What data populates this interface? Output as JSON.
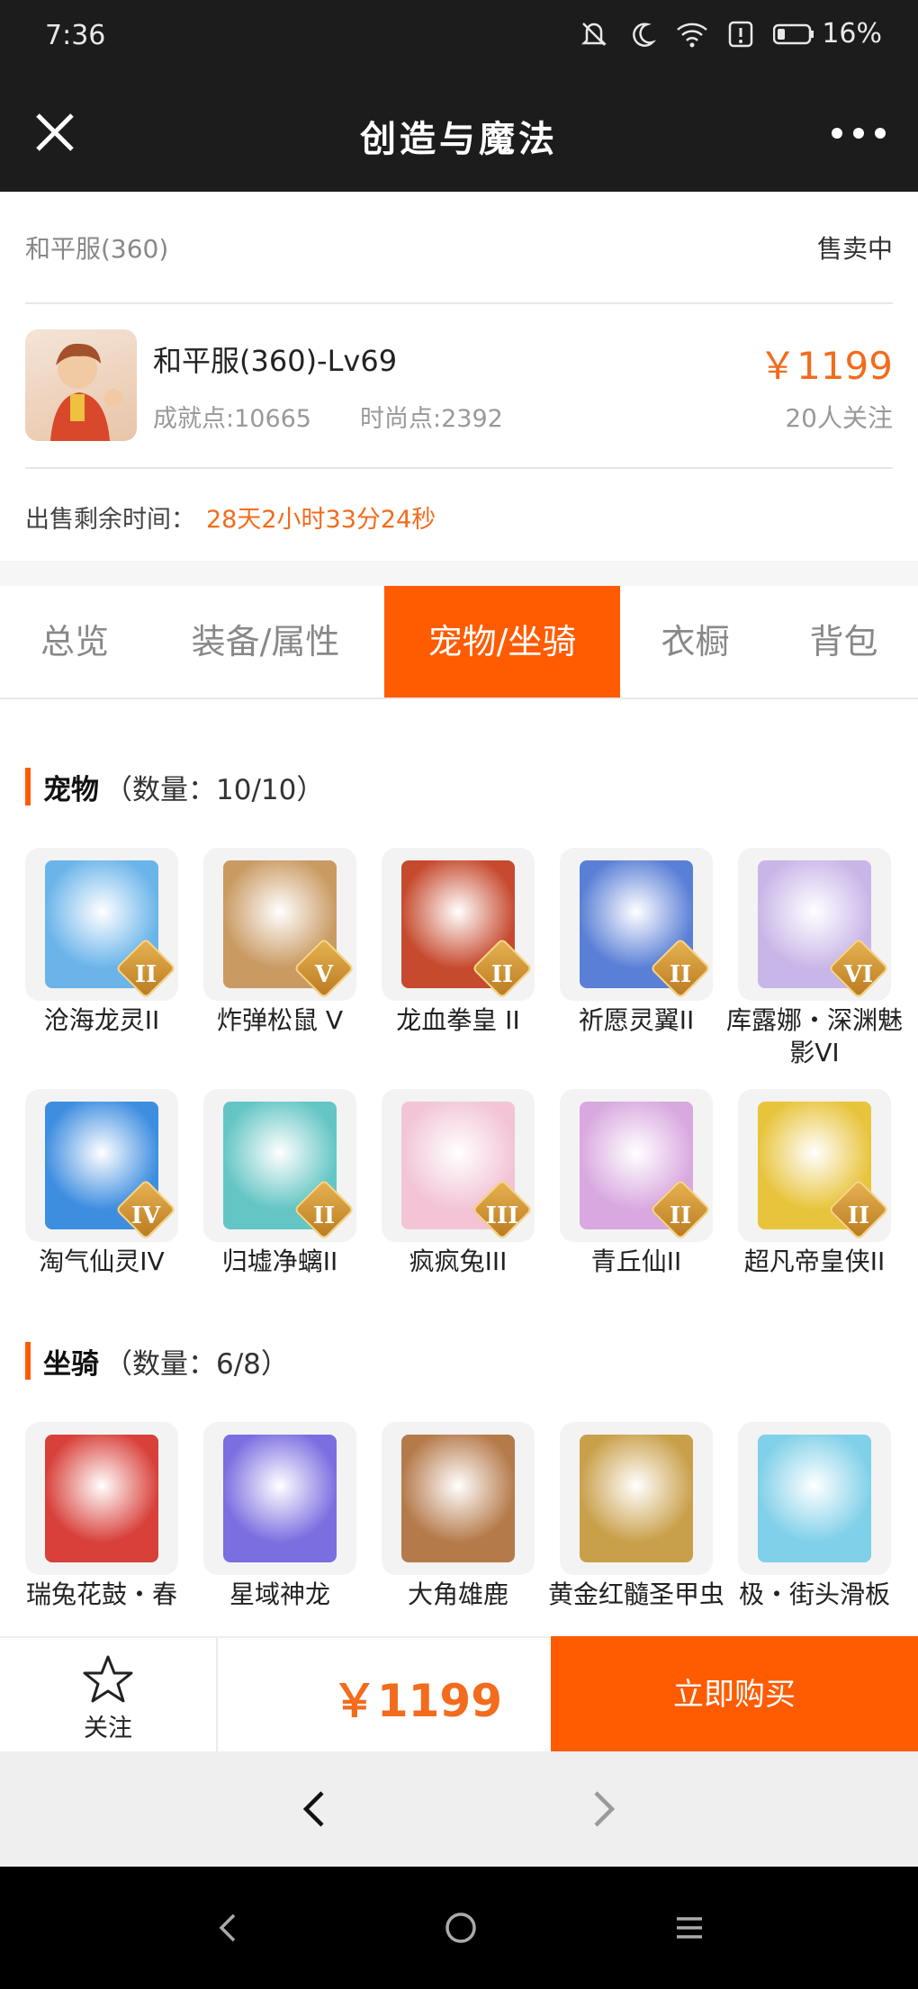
{
  "status_bar": {
    "time": "7:36",
    "battery_percent": "16%"
  },
  "title_bar": {
    "title": "创造与魔法"
  },
  "listing": {
    "server": "和平服(360)",
    "sale_status": "售卖中",
    "role_name": "和平服(360)-Lv69",
    "achievement": "成就点:10665",
    "fashion": "时尚点:2392",
    "price": "￥1199",
    "followers": "20人关注",
    "remaining_label": "出售剩余时间：",
    "remaining_value": "28天2小时33分24秒"
  },
  "tabs": [
    {
      "label": "总览",
      "active": false
    },
    {
      "label": "装备/属性",
      "active": false
    },
    {
      "label": "宠物/坐骑",
      "active": true
    },
    {
      "label": "衣橱",
      "active": false
    },
    {
      "label": "背包",
      "active": false
    }
  ],
  "pets": {
    "title": "宠物",
    "count": "（数量：10/10）",
    "items": [
      {
        "name": "沧海龙灵II",
        "badge": "II",
        "color": "#6ab4ea"
      },
      {
        "name": "炸弹松鼠 V",
        "badge": "V",
        "color": "#c99a62"
      },
      {
        "name": "龙血拳皇 II",
        "badge": "II",
        "color": "#c64a2e"
      },
      {
        "name": "祈愿灵翼II",
        "badge": "II",
        "color": "#5a7fd6"
      },
      {
        "name": "库露娜・深渊魅影VI",
        "badge": "VI",
        "color": "#c9b6e8"
      },
      {
        "name": "淘气仙灵IV",
        "badge": "IV",
        "color": "#3e8ee0"
      },
      {
        "name": "归墟净螭II",
        "badge": "II",
        "color": "#63c6c4"
      },
      {
        "name": "疯疯兔III",
        "badge": "III",
        "color": "#f2c4d6"
      },
      {
        "name": "青丘仙II",
        "badge": "II",
        "color": "#d9a8e0"
      },
      {
        "name": "超凡帝皇侠II",
        "badge": "II",
        "color": "#e8c43c"
      }
    ]
  },
  "mounts": {
    "title": "坐骑",
    "count": "（数量：6/8）",
    "items": [
      {
        "name": "瑞兔花鼓・春",
        "color": "#d8403a"
      },
      {
        "name": "星域神龙",
        "color": "#7b6ee0"
      },
      {
        "name": "大角雄鹿",
        "color": "#b57a4a"
      },
      {
        "name": "黄金红髓圣甲虫",
        "color": "#c9a04a"
      },
      {
        "name": "极・街头滑板",
        "color": "#7fd0e8"
      }
    ]
  },
  "action_bar": {
    "follow_label": "关注",
    "price": "￥1199",
    "buy_label": "立即购买"
  },
  "colors": {
    "accent": "#ff5b00",
    "price": "#f36b1c",
    "dark_bar": "#1c1c1c"
  }
}
